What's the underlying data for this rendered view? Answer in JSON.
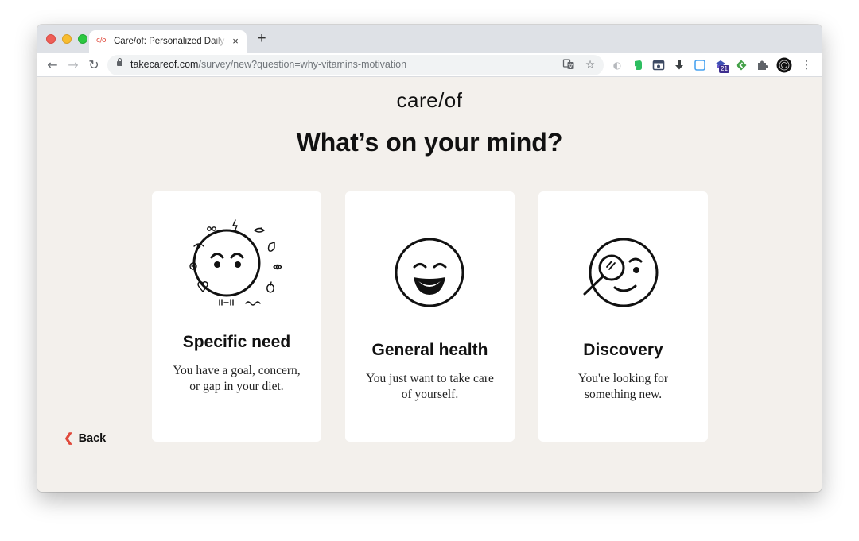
{
  "browser": {
    "tab_favicon": "c/o",
    "tab_title": "Care/of: Personalized Daily Vitamins",
    "tab_close": "×",
    "new_tab": "+",
    "url_host": "takecareof.com",
    "url_path": "/survey/new?question=why-vitamins-motivation",
    "extension_badge": "21",
    "icons": [
      "back-arrow-icon",
      "forward-arrow-icon",
      "reload-icon",
      "lock-icon",
      "translate-icon",
      "star-icon",
      "extension-icon",
      "evernote-icon",
      "screenshot-icon",
      "download-icon",
      "extension-icon",
      "extension-icon",
      "extension-icon",
      "puzzle-icon",
      "profile-icon",
      "kebab-menu-icon"
    ]
  },
  "page": {
    "logo": "care/of",
    "headline": "What’s on your mind?",
    "cards": [
      {
        "title": "Specific need",
        "description": "You have a goal, concern, or gap in your diet.",
        "icon": "face-with-wellness-icons"
      },
      {
        "title": "General health",
        "description": "You just want to take care of yourself.",
        "icon": "grinning-face-icon"
      },
      {
        "title": "Discovery",
        "description": "You're looking for something new.",
        "icon": "monocle-face-icon"
      }
    ],
    "back_label": "Back"
  },
  "colors": {
    "page_background": "#f3f0ec",
    "card_background": "#ffffff",
    "accent": "#e0493b",
    "text": "#111111"
  }
}
